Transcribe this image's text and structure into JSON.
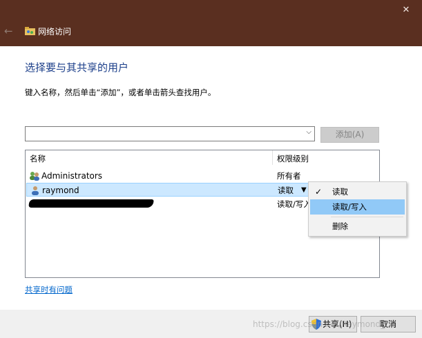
{
  "window": {
    "title": "网络访问",
    "close_glyph": "✕",
    "back_glyph": "←"
  },
  "main": {
    "heading": "选择要与其共享的用户",
    "instruction": "键入名称，然后单击“添加”，或者单击箭头查找用户。",
    "name_input": {
      "value": "",
      "placeholder": ""
    },
    "add_button_label": "添加(A)",
    "list": {
      "columns": [
        "名称",
        "权限级别"
      ],
      "rows": [
        {
          "name": "Administrators",
          "permission": "所有者",
          "icon": "user-group-icon",
          "selected": false
        },
        {
          "name": "raymond",
          "permission": "读取",
          "icon": "user-icon",
          "selected": true
        },
        {
          "name": "",
          "permission": "读取/写入",
          "icon": "",
          "selected": false,
          "redacted": true
        }
      ]
    },
    "permission_menu": {
      "items": [
        {
          "label": "读取",
          "checked": true
        },
        {
          "label": "读取/写入",
          "checked": false,
          "highlighted": true
        },
        {
          "label": "删除",
          "checked": false
        }
      ],
      "check_glyph": "✓"
    },
    "trouble_link": "共享时有问题"
  },
  "footer": {
    "share_label": "共享(H)",
    "cancel_label": "取消"
  },
  "watermark": "https://blog.csdn.net/Raymond_D",
  "colors": {
    "titlebar": "#5a2f20",
    "heading": "#1c3f8a",
    "link": "#0066cc",
    "selection": "#cce8ff",
    "menu_highlight": "#91c9f7"
  }
}
